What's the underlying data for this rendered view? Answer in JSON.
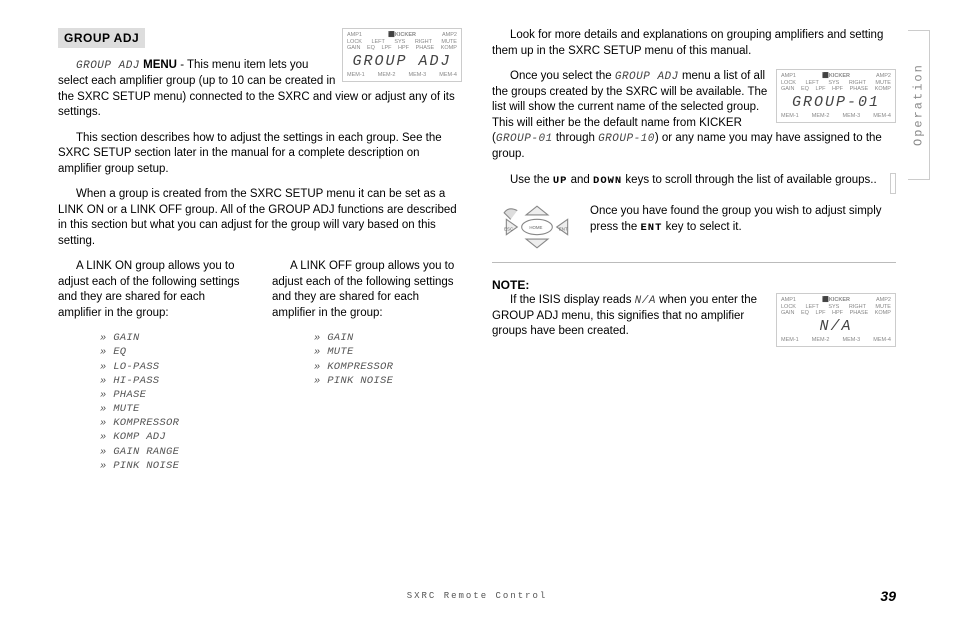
{
  "side_tab": "Operation",
  "footer": "SXRC Remote Control",
  "page_number": "39",
  "left": {
    "heading": "GROUP ADJ",
    "menu_stylized": "GROUP ADJ",
    "menu_bold": "MENU",
    "p1_rest": " - This menu item lets you select each amplifier group (up to 10 can be created in the SXRC SETUP menu) connected to the SXRC and view or adjust any of its settings.",
    "p2": "This section describes how to adjust the settings in each group. See the SXRC SETUP section later in the manual for a complete description on amplifier group setup.",
    "p3": "When a group is created from the SXRC SETUP menu it can be set as a LINK ON or a LINK OFF group. All of the GROUP ADJ functions are described in this section but what you can adjust for the group will vary based on this setting.",
    "linkon_intro": "A LINK ON group allows you to adjust each of the following settings and they are shared for each amplifier in the group:",
    "linkon_items": [
      "GAIN",
      "EQ",
      "LO-PASS",
      "HI-PASS",
      "PHASE",
      "MUTE",
      "KOMPRESSOR",
      "KOMP  ADJ",
      "GAIN RANGE",
      "PINK NOISE"
    ],
    "linkoff_intro": "A LINK OFF group allows you to adjust each of the following settings and they are shared for each amplifier in the group:",
    "linkoff_items": [
      "GAIN",
      "MUTE",
      "KOMPRESSOR",
      "PINK NOISE"
    ],
    "lcd1_main": "GROUP ADJ"
  },
  "right": {
    "p1": "Look for more details and explanations on grouping amplifiers and setting them up in the SXRC SETUP menu of this manual.",
    "p2_a": "Once you select the ",
    "p2_stylized": "GROUP ADJ",
    "p2_b": " menu a list of all the groups created by the SXRC will be available. The list will show the current name of the selected group. This will either be the default name from KICKER (",
    "p2_from": "GROUP-01",
    "p2_mid": " through ",
    "p2_to": "GROUP-10",
    "p2_c": ") or any name you may have assigned to the group.",
    "lcd2_main": "GROUP-01",
    "p3_a": "Use the ",
    "p3_up": "UP",
    "p3_mid": " and ",
    "p3_down": "DOWN",
    "p3_b": " keys to scroll through the list of available groups..",
    "p4_a": "Once you have found the group you wish to adjust simply press the ",
    "p4_ent": "ENT",
    "p4_b": " key to select it.",
    "note_label": "NOTE:",
    "note_a": "If the ISIS display reads ",
    "note_na": "N/A",
    "note_b": " when you enter the GROUP ADJ menu, this signifies that no amplifier groups have been created.",
    "lcd3_main": "N/A"
  },
  "lcd_labels": {
    "row1": [
      "AMP1",
      "",
      "",
      "",
      "",
      "AMP2"
    ],
    "row2": [
      "LOCK",
      "LEFT",
      "SYS",
      "RIGHT",
      "MUTE"
    ],
    "row3": [
      "GAIN",
      "EQ",
      "LPF",
      "HPF",
      "PHASE",
      "KOMP"
    ],
    "brand": "KICKER",
    "bot": [
      "MEM-1",
      "MEM-2",
      "MEM-3",
      "MEM-4"
    ]
  },
  "keypad_labels": {
    "esc": "ESC",
    "home": "HOME",
    "ent": "ENT"
  }
}
